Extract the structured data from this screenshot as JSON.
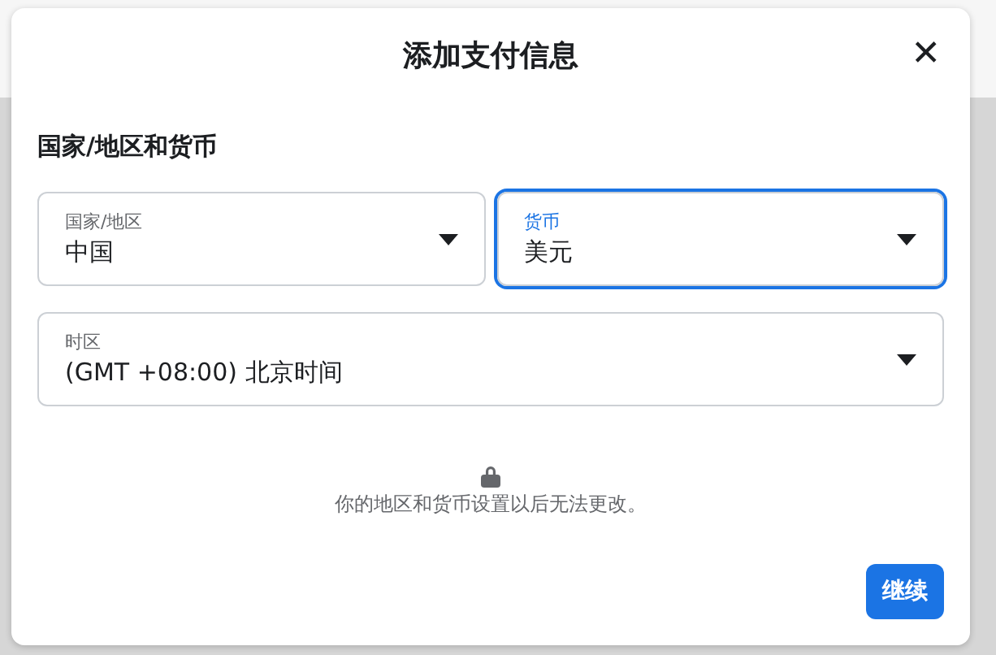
{
  "dialog": {
    "title": "添加支付信息",
    "close": "✕"
  },
  "section": {
    "heading": "国家/地区和货币"
  },
  "fields": [
    {
      "label": "国家/地区",
      "value": "中国",
      "focused": false
    },
    {
      "label": "货币",
      "value": "美元",
      "focused": true
    },
    {
      "label": "时区",
      "value": "(GMT +08:00) 北京时间",
      "focused": false
    }
  ],
  "note": "你的地区和货币设置以后无法更改。",
  "buttons": [
    {
      "label": "继续",
      "kind": "primary"
    }
  ]
}
